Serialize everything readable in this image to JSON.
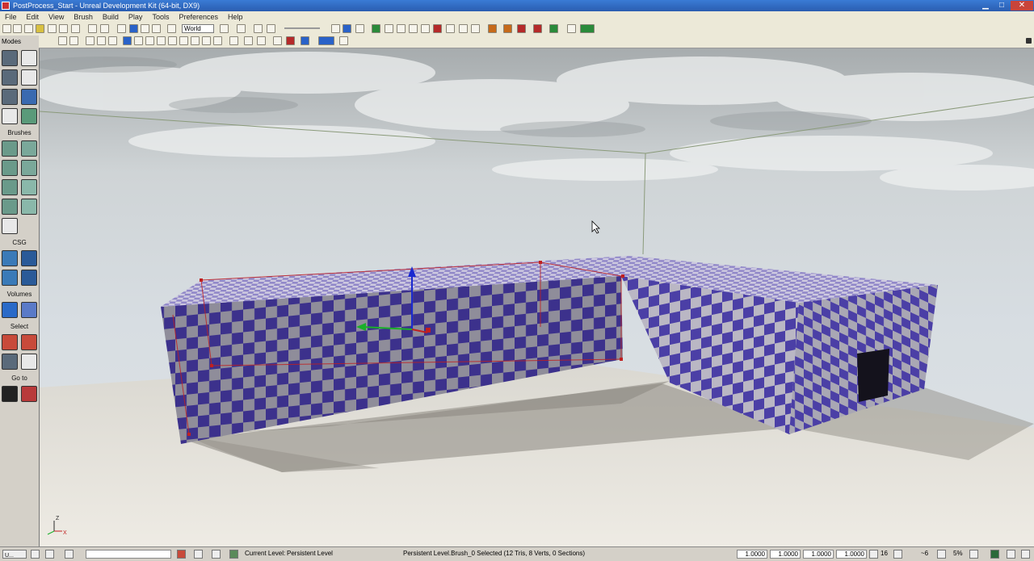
{
  "window": {
    "title": "PostProcess_Start - Unreal Development Kit (64-bit, DX9)",
    "controls": {
      "minimize": "▁",
      "maximize": "□",
      "close": "✕"
    }
  },
  "menu": [
    "File",
    "Edit",
    "View",
    "Brush",
    "Build",
    "Play",
    "Tools",
    "Preferences",
    "Help"
  ],
  "toolbar": {
    "coordinate_system": "World"
  },
  "sidebar": {
    "modes_label": "Modes",
    "sections": {
      "brushes": "Brushes",
      "csg": "CSG",
      "volumes": "Volumes",
      "select": "Select",
      "goto": "Go to"
    }
  },
  "viewport": {
    "axis_labels": {
      "z": "Z",
      "x": "X"
    }
  },
  "statusbar": {
    "task_label": "U...",
    "current_level_label": "Current Level:",
    "current_level": "Persistent Level",
    "selection_info": "Persistent Level.Brush_0 Selected (12 Tris, 8 Verts, 0 Sections)",
    "drag_grid_values": [
      "1.0000",
      "1.0000",
      "1.0000",
      "1.0000"
    ],
    "grid_size": "16",
    "rotation_snap": "~6",
    "scale_snap": "5%"
  },
  "colors": {
    "title_bar": "#2a5db0",
    "checker_blue": "#4a3fa0",
    "checker_light": "#c8c6cc",
    "sky": "#c9cfd4",
    "ground": "#e8e4dc"
  }
}
